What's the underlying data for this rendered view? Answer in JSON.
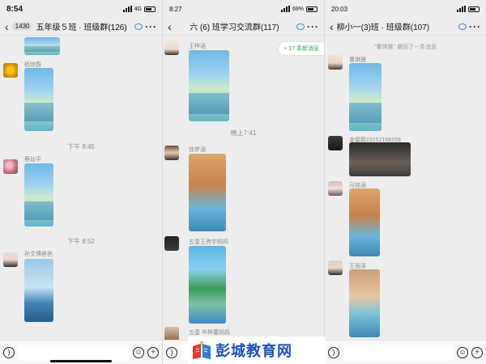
{
  "panel1": {
    "status": {
      "time": "8:54",
      "network": "4G"
    },
    "nav": {
      "back": "‹",
      "unread": "1430",
      "title": "五年级５班 · 班级群(126)",
      "more": "···"
    },
    "messages": [
      {
        "type": "sender",
        "name": "杨琼蔚"
      },
      {
        "type": "time",
        "text": "下午 8:45"
      },
      {
        "type": "sender",
        "name": "蔡幼平"
      },
      {
        "type": "time",
        "text": "下午 8:52"
      },
      {
        "type": "sender",
        "name": "孙文博爸爸"
      }
    ]
  },
  "panel2": {
    "status": {
      "time": "8:27",
      "battery": "69%"
    },
    "nav": {
      "back": "‹",
      "title": "六 (6) 班学习交流群(117)",
      "more": "···"
    },
    "new_messages": "17 条新消息",
    "messages": [
      {
        "type": "sender",
        "name": "王梓涵"
      },
      {
        "type": "time",
        "text": "晚上7:41"
      },
      {
        "type": "sender",
        "name": "徐梦涵"
      },
      {
        "type": "sender",
        "name": "五壹王煦宇妈妈"
      },
      {
        "type": "sender",
        "name": "五壹 毕梓蕾妈妈"
      }
    ]
  },
  "panel3": {
    "status": {
      "time": "20:03"
    },
    "nav": {
      "back": "‹",
      "title": "柳小一(3)班 · 班级群(107)",
      "more": "···"
    },
    "system": "\"曹琪雅\" 撤回了一条消息",
    "messages": [
      {
        "type": "sender",
        "name": "曹琪雅"
      },
      {
        "type": "sender",
        "name": "金俊熙15152168159"
      },
      {
        "type": "sender",
        "name": "马铭涵"
      },
      {
        "type": "sender",
        "name": "王雨泽"
      }
    ]
  },
  "watermark": {
    "text": "彭城教育网"
  },
  "colors": {
    "background": "#ededed",
    "accent_green": "#22a65a",
    "link_blue": "#3b88e0",
    "logo_blue": "#1d4fb8"
  }
}
